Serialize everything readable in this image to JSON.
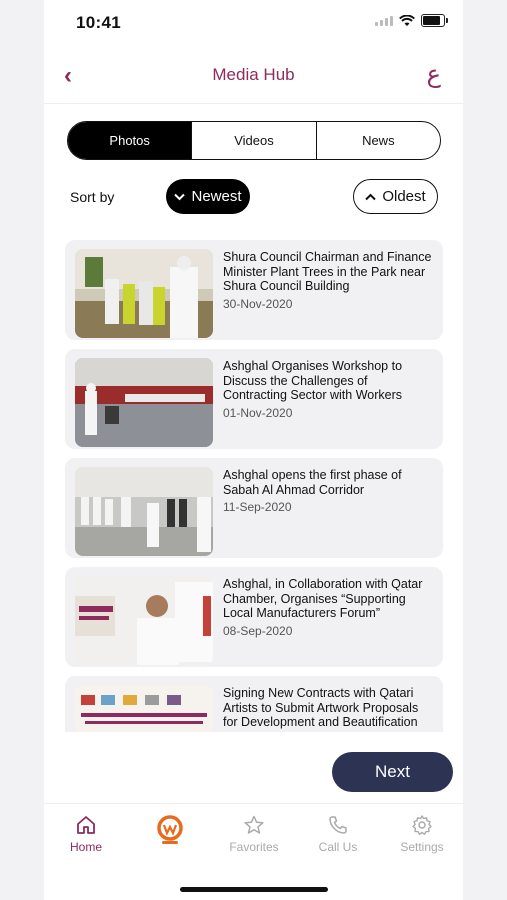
{
  "status": {
    "time": "10:41"
  },
  "header": {
    "title": "Media Hub",
    "lang_toggle": "ع"
  },
  "segments": [
    {
      "label": "Photos",
      "active": true
    },
    {
      "label": "Videos",
      "active": false
    },
    {
      "label": "News",
      "active": false
    }
  ],
  "sort": {
    "label": "Sort by",
    "newest": "Newest",
    "oldest": "Oldest"
  },
  "items": [
    {
      "title": "Shura Council Chairman and Finance Minister Plant Trees in the Park near Shura Council Building",
      "date": "30-Nov-2020"
    },
    {
      "title": "Ashghal Organises Workshop to Discuss the Challenges of Contracting Sector with Workers",
      "date": "01-Nov-2020"
    },
    {
      "title": "Ashghal opens the first phase of Sabah Al Ahmad Corridor",
      "date": "11-Sep-2020"
    },
    {
      "title": "Ashghal, in Collaboration with Qatar Chamber, Organises “Supporting Local Manufacturers Forum”",
      "date": "08-Sep-2020"
    },
    {
      "title": "Signing New Contracts with Qatari Artists to Submit Artwork Proposals for Development and Beautification",
      "date": ""
    }
  ],
  "next_label": "Next",
  "tabs": [
    {
      "label": "Home",
      "icon": "home-icon",
      "active": true
    },
    {
      "label": "",
      "icon": "qmic-logo-icon",
      "active": false
    },
    {
      "label": "Favorites",
      "icon": "star-icon",
      "active": false
    },
    {
      "label": "Call Us",
      "icon": "phone-icon",
      "active": false
    },
    {
      "label": "Settings",
      "icon": "gear-icon",
      "active": false
    }
  ],
  "colors": {
    "accent": "#8e2a5e",
    "next_button": "#2c3353",
    "qmic_orange": "#e86a1f"
  }
}
